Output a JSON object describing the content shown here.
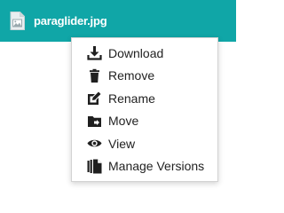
{
  "file": {
    "name": "paraglider.jpg",
    "icon": "image-file-icon"
  },
  "context_menu": {
    "items": [
      {
        "label": "Download",
        "icon": "download-icon"
      },
      {
        "label": "Remove",
        "icon": "trash-icon"
      },
      {
        "label": "Rename",
        "icon": "rename-icon"
      },
      {
        "label": "Move",
        "icon": "move-folder-icon"
      },
      {
        "label": "View",
        "icon": "eye-icon"
      },
      {
        "label": "Manage Versions",
        "icon": "versions-icon"
      }
    ]
  },
  "colors": {
    "row_background": "#10a6a7",
    "icon_color": "#1f1f1f",
    "menu_text": "#222222"
  }
}
